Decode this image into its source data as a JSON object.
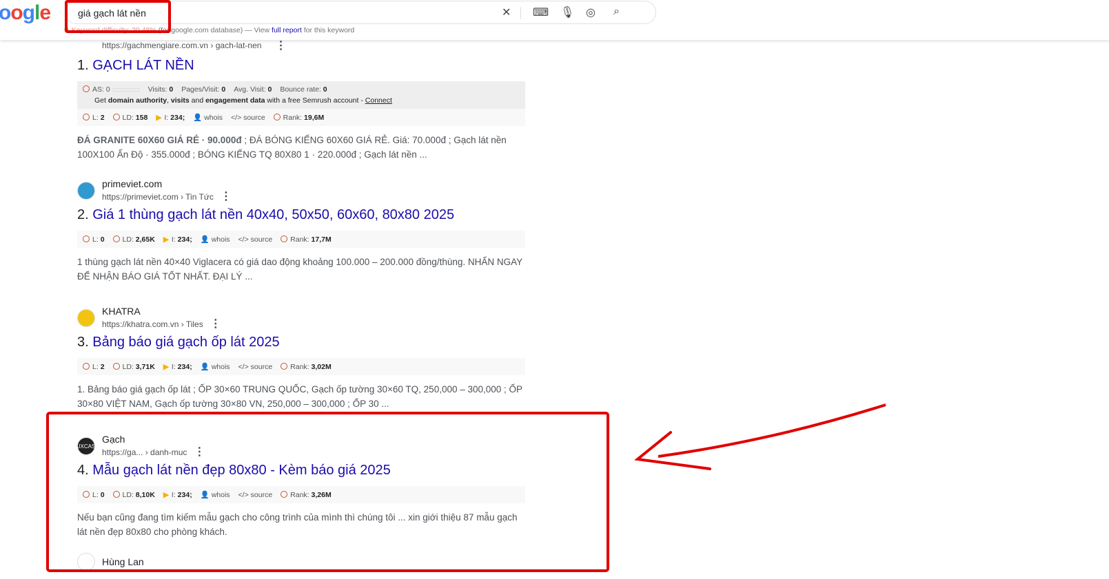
{
  "header": {
    "logo": "ogle",
    "query": "giá gạch lát nền",
    "keyword_difficulty": {
      "label": "Keyword difficulty: 20.48%",
      "db": "(for google.com database) — View",
      "link": "full report",
      "tail": "for this keyword"
    }
  },
  "icons": [
    "close-icon",
    "keyboard-icon",
    "mic-icon",
    "lens-icon",
    "search-icon"
  ],
  "results": [
    {
      "num": "1.",
      "site": "",
      "url": "https://gachmengiare.com.vn › gach-lat-nen",
      "title": "GẠCH LÁT NỀN",
      "semrush": {
        "as": "AS: 0",
        "visits": "Visits:",
        "visits_v": "0",
        "pv": "Pages/Visit:",
        "pv_v": "0",
        "avg": "Avg. Visit:",
        "avg_v": "0",
        "br": "Bounce rate:",
        "br_v": "0",
        "cta1": "Get",
        "cta2": "domain authority",
        "cta3": ", ",
        "cta4": "visits",
        "cta5": " and ",
        "cta6": "engagement data",
        "cta7": " with a free Semrush account - ",
        "connect": "Connect"
      },
      "l": "2",
      "ld": "158",
      "i": "234;",
      "rank": "19,6M",
      "snippet_b": "ĐÁ GRANITE 60X60 GIÁ RẺ · 90.000đ",
      "snippet": " ; ĐÁ BÓNG KIẾNG 60X60 GIÁ RẺ. Giá: 70.000đ ; Gạch lát nền 100X100 Ấn Độ · 355.000đ ; BÓNG KIẾNG TQ 80X80 1 · 220.000đ ; Gạch lát nền ..."
    },
    {
      "num": "2.",
      "site": "primeviet.com",
      "url": "https://primeviet.com › Tin Tức",
      "title": "Giá 1 thùng gạch lát nền 40x40, 50x50, 60x60, 80x80 2025",
      "l": "0",
      "ld": "2,65K",
      "i": "234;",
      "rank": "17,7M",
      "snippet": "1 thùng gạch lát nền 40×40 Viglacera có giá dao động khoảng 100.000 – 200.000 đồng/thùng. NHẤN NGAY ĐỂ NHẬN BÁO GIÁ TỐT NHẤT. ĐẠI LÝ ..."
    },
    {
      "num": "3.",
      "site": "KHATRA",
      "url": "https://khatra.com.vn › Tiles",
      "title": "Bảng báo giá gạch ốp lát 2025",
      "l": "2",
      "ld": "3,71K",
      "i": "234;",
      "rank": "3,02M",
      "snippet": "1. Bảng báo giá gạch ốp lát ; ỐP 30×60 TRUNG QUỐC, Gạch ốp tường 30×60 TQ, 250,000 – 300,000 ; ỐP 30×80 VIỆT NAM, Gạch ốp tường 30×80 VN, 250,000 – 300,000 ; ỐP 30 ..."
    },
    {
      "num": "4.",
      "site": "Gạch",
      "url": "https://ga... › danh-muc",
      "title": "Mẫu gạch lát nền đẹp 80x80 - Kèm báo giá 2025",
      "l": "0",
      "ld": "8,10K",
      "i": "234;",
      "rank": "3,26M",
      "snippet": "Nếu bạn cũng đang tìm kiếm mẫu gạch cho công trình của mình thì chúng tôi ... xin giới thiệu 87 mẫu gạch lát nền đẹp 80x80 cho phòng khách."
    },
    {
      "site": "Hùng Lan"
    }
  ],
  "labels": {
    "l": "L:",
    "ld": "LD:",
    "i": "I:",
    "whois": "whois",
    "source": "source",
    "rank": "Rank:"
  },
  "annotation_color": "#e00000"
}
